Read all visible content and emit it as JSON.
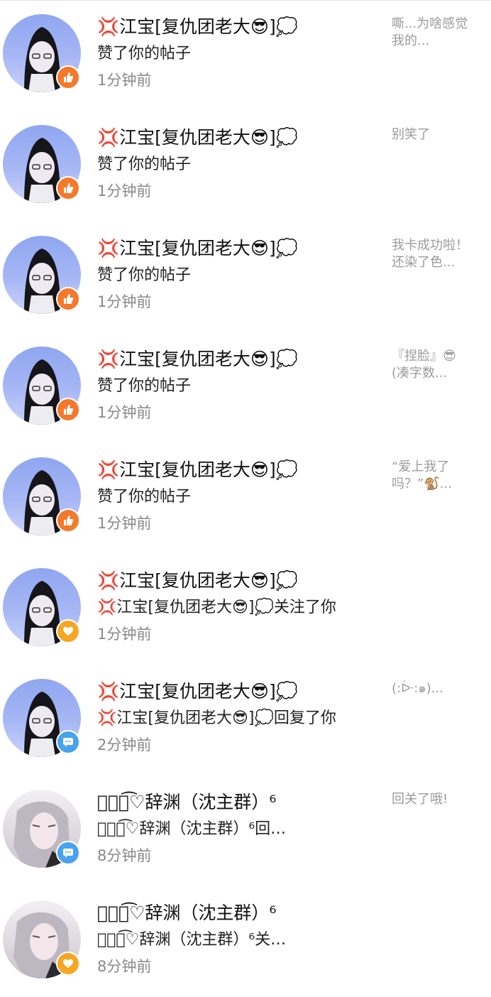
{
  "notifications": [
    {
      "avatar": "blue",
      "badge": "like",
      "badge_icon": "thumbs-up-icon",
      "name": "💢江宝[复仇团老大😎]💭",
      "action": "赞了你的帖子",
      "time": "1分钟前",
      "preview": "嘶...为啥感觉我的..."
    },
    {
      "avatar": "blue",
      "badge": "like",
      "badge_icon": "thumbs-up-icon",
      "name": "💢江宝[复仇团老大😎]💭",
      "action": "赞了你的帖子",
      "time": "1分钟前",
      "preview": "别笑了"
    },
    {
      "avatar": "blue",
      "badge": "like",
      "badge_icon": "thumbs-up-icon",
      "name": "💢江宝[复仇团老大😎]💭",
      "action": "赞了你的帖子",
      "time": "1分钟前",
      "preview": "我卡成功啦！还染了色..."
    },
    {
      "avatar": "blue",
      "badge": "like",
      "badge_icon": "thumbs-up-icon",
      "name": "💢江宝[复仇团老大😎]💭",
      "action": "赞了你的帖子",
      "time": "1分钟前",
      "preview": "『捏脸』😎(凑字数..."
    },
    {
      "avatar": "blue",
      "badge": "like",
      "badge_icon": "thumbs-up-icon",
      "name": "💢江宝[复仇团老大😎]💭",
      "action": "赞了你的帖子",
      "time": "1分钟前",
      "preview": "“爱上我了吗？”🐒..."
    },
    {
      "avatar": "blue",
      "badge": "follow",
      "badge_icon": "heart-icon",
      "name": "💢江宝[复仇团老大😎]💭",
      "action": "💢江宝[复仇团老大😎]💭关注了你",
      "time": "1分钟前",
      "preview": ""
    },
    {
      "avatar": "blue",
      "badge": "comment",
      "badge_icon": "chat-bubble-icon",
      "name": "💢江宝[复仇团老大😎]💭",
      "action": "💢江宝[复仇团老大😎]💭回复了你",
      "time": "2分钟前",
      "preview": "(:ᐕ:๑)..."
    },
    {
      "avatar": "grey",
      "badge": "comment",
      "badge_icon": "chat-bubble-icon",
      "name": "༺ཱི͡♡辞渊（沈主群）⁶",
      "action": "༺ཱི͡♡辞渊（沈主群）⁶回…",
      "time": "8分钟前",
      "preview": "回关了哦!"
    },
    {
      "avatar": "grey",
      "badge": "follow",
      "badge_icon": "heart-icon",
      "name": "༺ཱི͡♡辞渊（沈主群）⁶",
      "action": "༺ཱི͡♡辞渊（沈主群）⁶关…",
      "time": "8分钟前",
      "preview": ""
    }
  ],
  "colors": {
    "like_badge": "#f4792a",
    "follow_badge": "#f6a623",
    "comment_badge": "#47a2f0",
    "time_text": "#888888",
    "preview_text": "#9b9b9b"
  }
}
